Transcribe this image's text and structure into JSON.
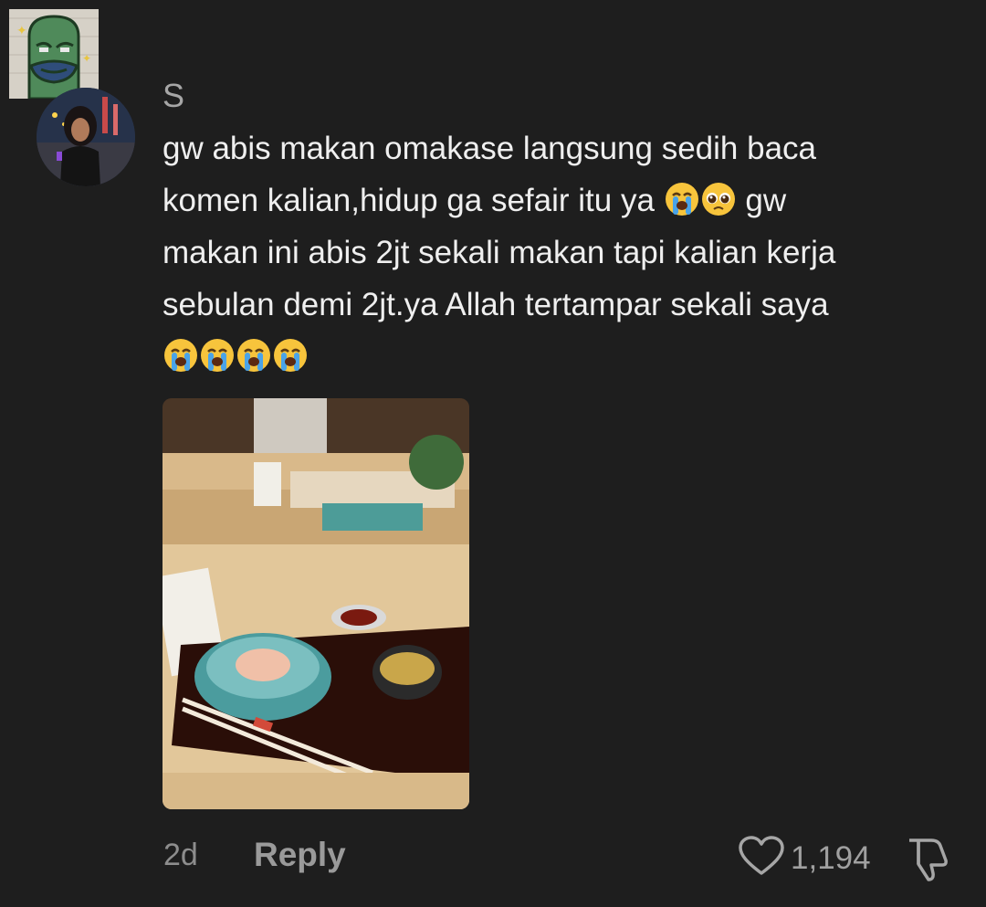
{
  "comment": {
    "username": "S",
    "text_lines": [
      "gw abis makan omakase langsung sedih baca",
      "komen kalian,hidup ga sefair itu ya",
      "gw",
      "makan ini abis 2jt sekali makan tapi kalian kerja",
      "sebulan demi 2jt.ya Allah tertampar sekali saya"
    ],
    "emojis": [
      "loudly-crying-face",
      "pleading-face",
      "loudly-crying-face"
    ],
    "time": "2d",
    "reply_label": "Reply",
    "like_count": "1,194"
  },
  "icons": {
    "like": "heart-outline-icon",
    "dislike": "thumbs-down-outline-icon"
  },
  "colors": {
    "background": "#1e1e1e",
    "text": "#efefef",
    "muted": "#8d8d8d"
  }
}
